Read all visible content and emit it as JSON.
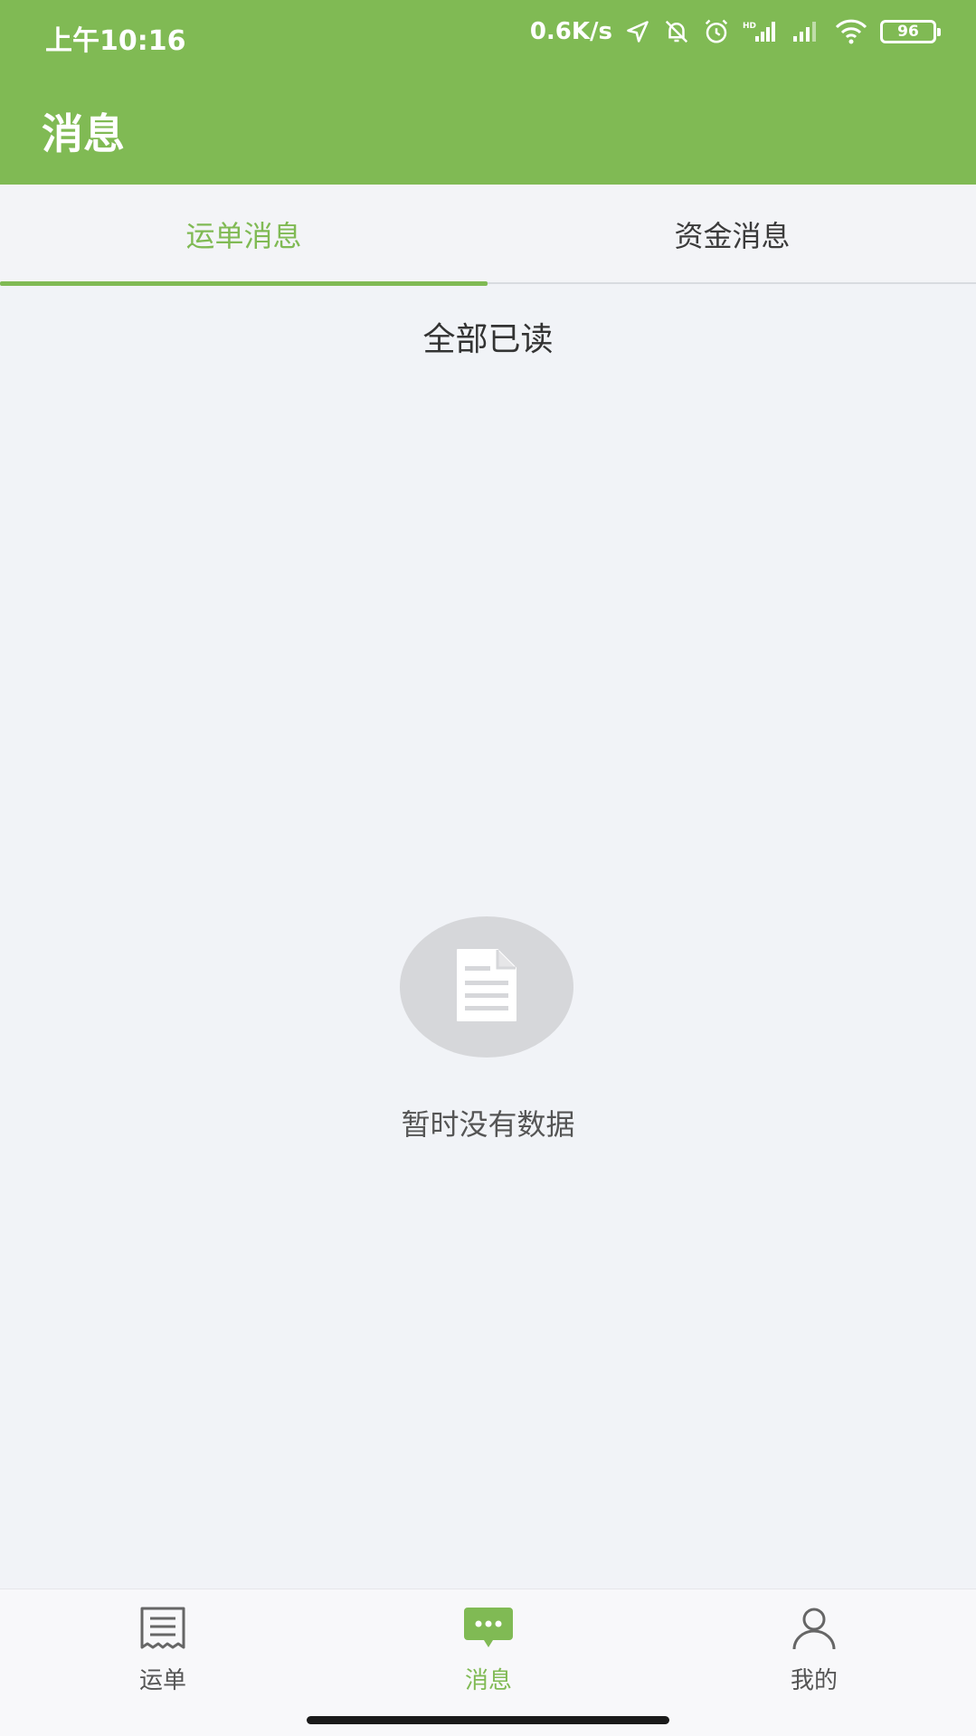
{
  "status_bar": {
    "time": "上午10:16",
    "net_speed": "0.6K/s",
    "battery": "96",
    "icons": [
      "location-arrow-icon",
      "bell-off-icon",
      "alarm-icon",
      "signal-hd-icon",
      "signal-icon",
      "wifi-icon",
      "battery-icon"
    ]
  },
  "app_bar": {
    "title": "消息"
  },
  "tabs": [
    {
      "label": "运单消息",
      "active": true
    },
    {
      "label": "资金消息",
      "active": false
    }
  ],
  "actions": {
    "mark_all_read": "全部已读"
  },
  "empty_state": {
    "icon": "document-icon",
    "text": "暂时没有数据"
  },
  "bottom_nav": [
    {
      "label": "运单",
      "icon": "waybill-icon",
      "active": false
    },
    {
      "label": "消息",
      "icon": "message-icon",
      "active": true
    },
    {
      "label": "我的",
      "icon": "user-icon",
      "active": false
    }
  ],
  "colors": {
    "accent": "#80ba54",
    "background": "#f1f3f7",
    "empty_circle": "#d6d7da"
  }
}
